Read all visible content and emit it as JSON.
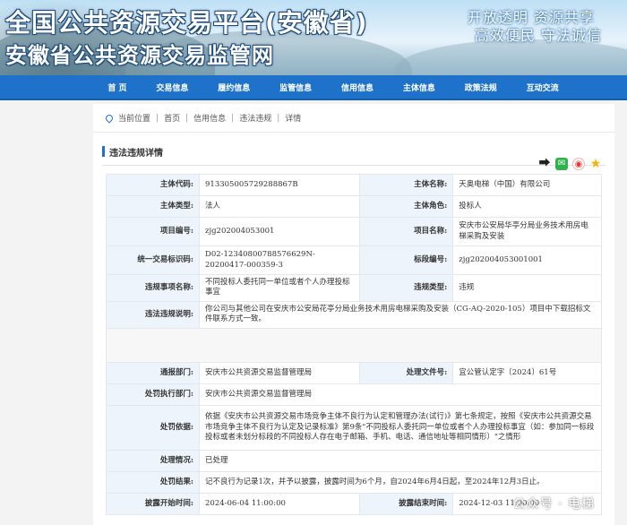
{
  "banner": {
    "title_line1": "全国公共资源交易平台(安徽省)",
    "title_line2": "安徽省公共资源交易监管网",
    "slogan_line1": "开放透明  资源共享",
    "slogan_line2": "高效便民  守法诚信"
  },
  "nav": [
    "首 页",
    "交易信息",
    "履约信息",
    "监管信息",
    "信用信息",
    "主体信息",
    "政策法规",
    "互动交流"
  ],
  "breadcrumb": {
    "label": "当前位置",
    "items": [
      "首页",
      "信用信息",
      "违法违规",
      "详情"
    ]
  },
  "section_title": "违法违规详情",
  "icons": [
    "share-icon",
    "wechat-icon",
    "weibo-icon",
    "star-icon"
  ],
  "fields": {
    "code_label": "主体代码:",
    "code_value": "913305005729288867B",
    "name_label": "主体名称:",
    "name_value": "天奥电梯（中国）有限公司",
    "type_label": "主体类型:",
    "type_value": "法人",
    "role_label": "主体角色:",
    "role_value": "投标人",
    "proj_no_label": "项目编号:",
    "proj_no_value": "zjg202004053001",
    "proj_name_label": "项目名称:",
    "proj_name_value": "安庆市公安局华亭分局业务技术用房电梯采购及安装",
    "trade_code_label": "统一交易标识码:",
    "trade_code_value": "D02-12340800788576629N-20200417-000359-3",
    "section_no_label": "标段编号:",
    "section_no_value": "zjg202004053001001",
    "violation_item_label": "违规事项名称:",
    "violation_item_value": "不同投标人委托同一单位或者个人办理投标事宜",
    "violation_type_label": "违规类型:",
    "violation_type_value": "违规",
    "desc_label": "违法违规说明:",
    "desc_value": "你公司与其他公司在安庆市公安局花亭分局业务技术用房电梯采购及安装（CG-AQ-2020-105）项目中下载招标文件联系方式一致。",
    "notify_dept_label": "通报部门:",
    "notify_dept_value": "安庆市公共资源交易监督管理局",
    "doc_no_label": "处理文件号:",
    "doc_no_value": "宜公管认定字〔2024〕61号",
    "exec_dept_label": "处罚执行部门:",
    "exec_dept_value": "安庆市公共资源交易监督管理局",
    "basis_label": "处罚依据:",
    "basis_value": "依据《安庆市公共资源交易市场竞争主体不良行为认定和管理办法(试行)》第七条规定，按照《安庆市公共资源交易市场竞争主体不良行为认定及记录标准》第9条\"不同投标人委托同一单位或者个人办理投标事宜（如：参加同一标段投标或者未划分标段的不同投标人存在电子邮箱、手机、电话、通信地址等相同情形）\"之情形",
    "status_label": "处理情况:",
    "status_value": "已处理",
    "result_label": "处罚结果:",
    "result_value": "记不良行为记录1次，并予以披露，披露时间为6个月，自2024年6月4日起，至2024年12月3日止。",
    "start_label": "披露开始时间:",
    "start_value": "2024-06-04 11:00:00",
    "end_label": "披露结束时间:",
    "end_value": "2024-12-03 11:00:00"
  },
  "watermark": "公众号 · 电梯"
}
